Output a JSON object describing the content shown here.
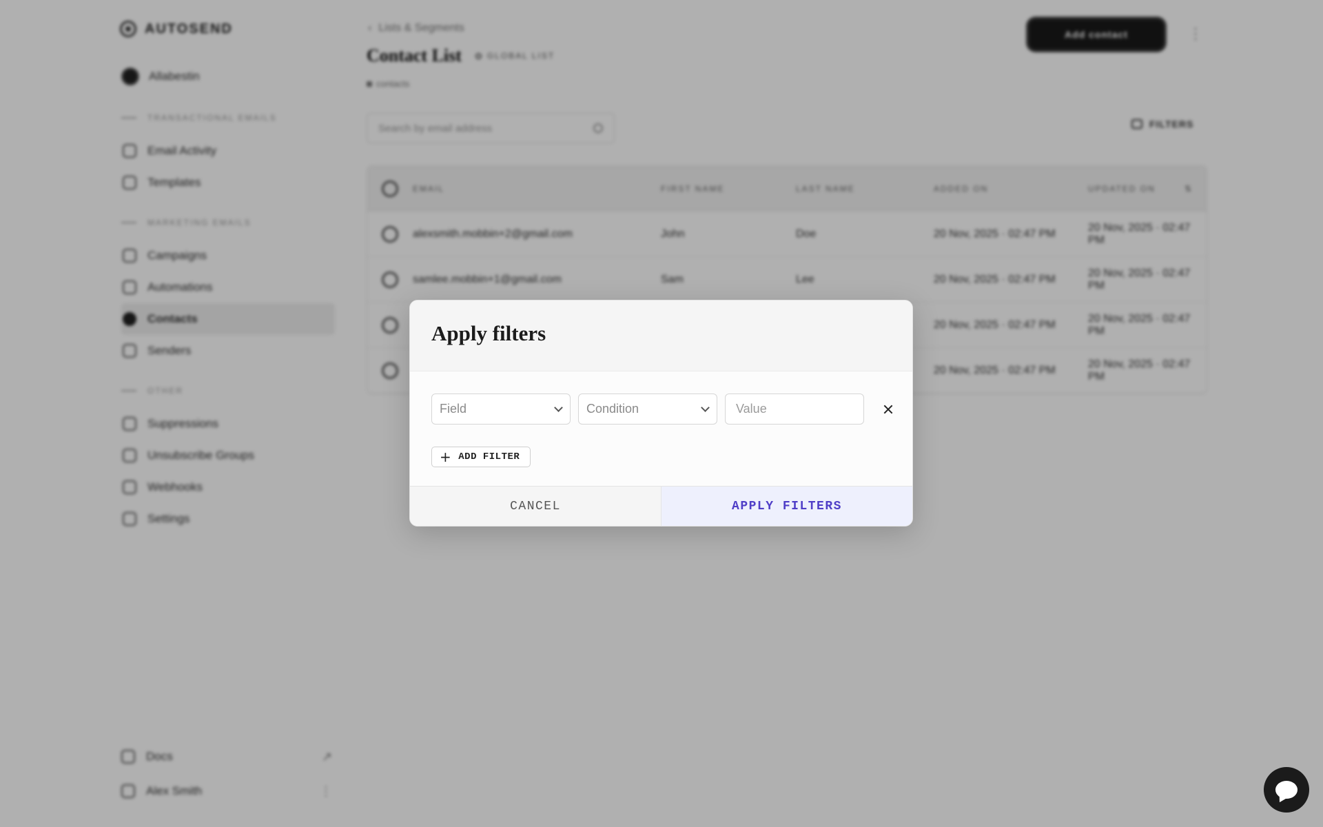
{
  "app": {
    "brand": "AUTOSEND",
    "workspace": "Allabestin"
  },
  "sidebar": {
    "sections": [
      {
        "heading": "TRANSACTIONAL EMAILS",
        "items": [
          {
            "label": "Email Activity"
          },
          {
            "label": "Templates"
          }
        ]
      },
      {
        "heading": "MARKETING EMAILS",
        "items": [
          {
            "label": "Campaigns"
          },
          {
            "label": "Automations"
          },
          {
            "label": "Contacts"
          },
          {
            "label": "Senders"
          }
        ]
      },
      {
        "heading": "OTHER",
        "items": [
          {
            "label": "Suppressions"
          },
          {
            "label": "Unsubscribe Groups"
          },
          {
            "label": "Webhooks"
          },
          {
            "label": "Settings"
          }
        ]
      }
    ],
    "bottom": [
      {
        "label": "Docs",
        "trail": "↗"
      },
      {
        "label": "Alex Smith",
        "trail": "⋮"
      }
    ]
  },
  "main": {
    "breadcrumb": "Lists & Segments",
    "title": "Contact List",
    "badge": "GLOBAL LIST",
    "subtitle": "contacts",
    "top_action": "Add contact",
    "search_placeholder": "Search by email address",
    "filters_label": "FILTERS",
    "columns": [
      "EMAIL",
      "FIRST NAME",
      "LAST NAME",
      "ADDED ON",
      "UPDATED ON"
    ],
    "rows": [
      {
        "email": "alexsmith.mobbin+2@gmail.com",
        "first": "John",
        "last": "Doe",
        "added": "20 Nov, 2025 · 02:47 PM",
        "updated": "20 Nov, 2025 · 02:47 PM"
      },
      {
        "email": "samlee.mobbin+1@gmail.com",
        "first": "Sam",
        "last": "Lee",
        "added": "20 Nov, 2025 · 02:47 PM",
        "updated": "20 Nov, 2025 · 02:47 PM"
      },
      {
        "email": "",
        "first": "",
        "last": "",
        "added": "20 Nov, 2025 · 02:47 PM",
        "updated": "20 Nov, 2025 · 02:47 PM"
      },
      {
        "email": "",
        "first": "",
        "last": "",
        "added": "20 Nov, 2025 · 02:47 PM",
        "updated": "20 Nov, 2025 · 02:47 PM"
      }
    ]
  },
  "modal": {
    "title": "Apply filters",
    "field_placeholder": "Field",
    "condition_placeholder": "Condition",
    "value_placeholder": "Value",
    "add_filter": "ADD FILTER",
    "cancel": "CANCEL",
    "apply": "APPLY FILTERS"
  },
  "icons": {
    "remove": "close-icon",
    "add": "plus-icon",
    "dropdown": "chevron-down-icon",
    "chat": "chat-bubble-icon"
  },
  "colors": {
    "accent": "#4f3ec7",
    "apply_bg": "#eef0fd",
    "overlay": "rgba(0,0,0,0.31)"
  }
}
